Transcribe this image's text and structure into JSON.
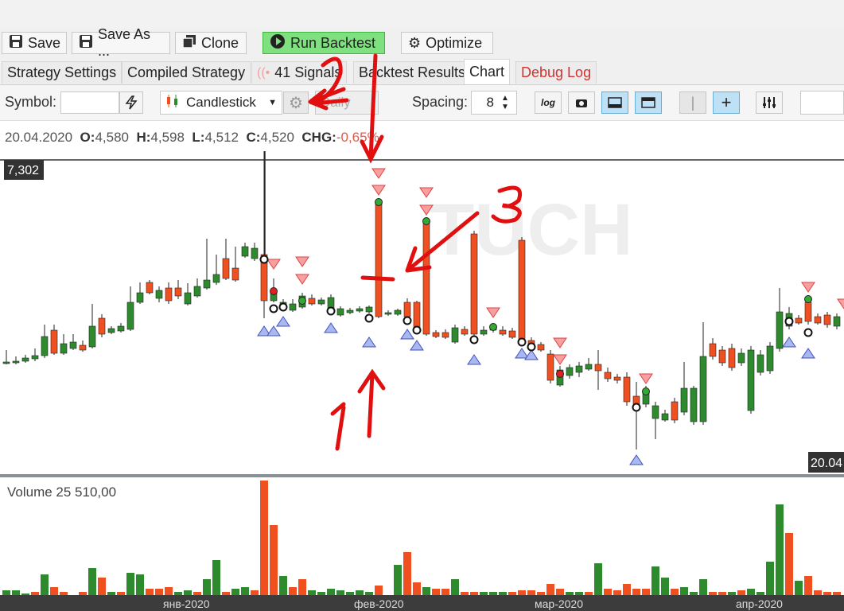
{
  "toolbar": {
    "save": "Save",
    "save_as": "Save As ...",
    "clone": "Clone",
    "run_backtest": "Run Backtest",
    "optimize": "Optimize"
  },
  "tabs": {
    "strategy_settings": "Strategy Settings",
    "compiled_strategy": "Compiled Strategy",
    "signals": "41 Signals",
    "backtest_results": "Backtest Results",
    "chart": "Chart",
    "debug_log": "Debug Log",
    "active": "Chart"
  },
  "options": {
    "symbol_label": "Symbol:",
    "symbol_value": "",
    "chart_type": "Candlestick",
    "timeframe": "Daily",
    "spacing_label": "Spacing:",
    "spacing_value": "8",
    "log_button": "log"
  },
  "ohlc": {
    "date": "20.04.2020",
    "o_label": "O:",
    "o": "4,580",
    "h_label": "H:",
    "h": "4,598",
    "l_label": "L:",
    "l": "4,512",
    "c_label": "C:",
    "c": "4,520",
    "chg_label": "CHG:",
    "chg": "-0,65%"
  },
  "chart": {
    "price_crosshair_label": "7,302",
    "date_crosshair_label": "20.04",
    "watermark": "TUCH",
    "volume_label": "Volume 25 510,00",
    "month_labels": [
      "янв-2020",
      "фев-2020",
      "мар-2020",
      "апр-2020"
    ],
    "colors": {
      "up": "#2d8a2d",
      "down": "#f05020",
      "signal_up": "#a9b8f0",
      "signal_down": "#f7a0a0"
    }
  },
  "annotations": {
    "one": "1",
    "two": "2",
    "three": "3"
  }
}
